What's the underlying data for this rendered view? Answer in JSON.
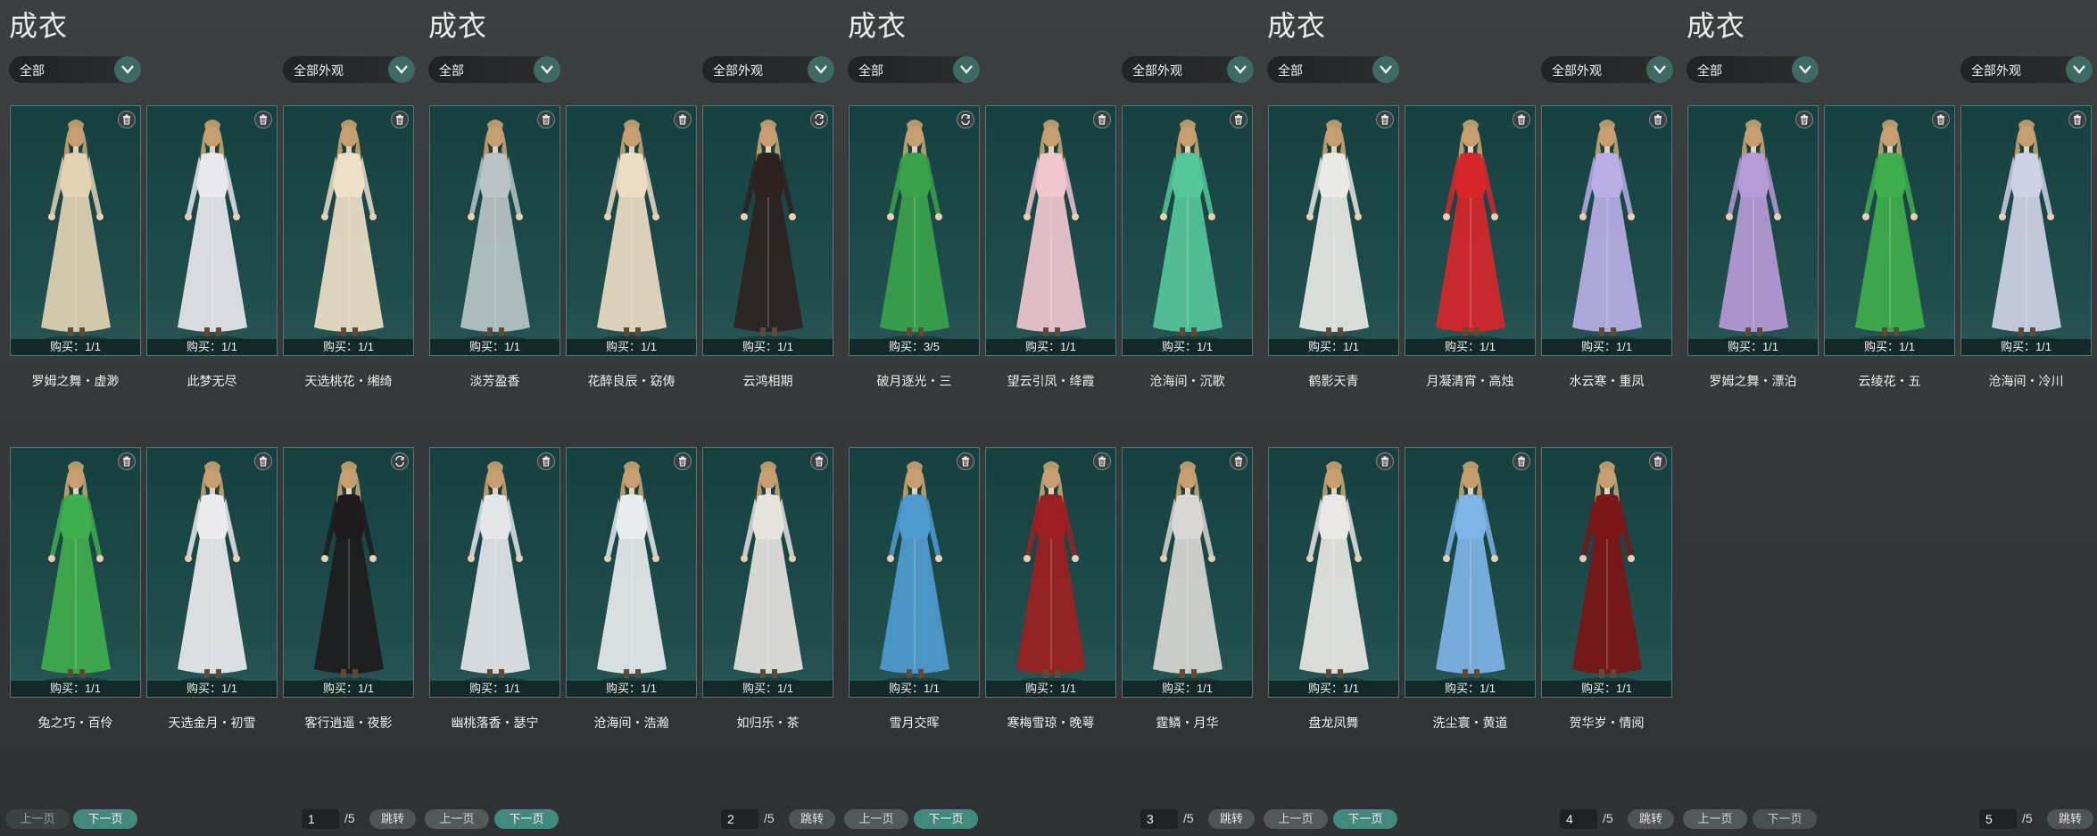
{
  "colors": {
    "background": "#363a3b",
    "card": "#1b4847",
    "accent": "#3f8a7c"
  },
  "pages": [
    {
      "title": "成衣",
      "category_select": "全部",
      "appearance_select": "全部外观",
      "cards": [
        {
          "name": "罗姆之舞・虚渺",
          "purchase": "购买：1/1",
          "icon": "trash-icon",
          "outfit": "#e2d3b4"
        },
        {
          "name": "此梦无尽",
          "purchase": "购买：1/1",
          "icon": "trash-icon",
          "outfit": "#e8e8ee"
        },
        {
          "name": "天选桃花・缃绮",
          "purchase": "购买：1/1",
          "icon": "trash-icon",
          "outfit": "#eedfc8"
        },
        {
          "name": "兔之巧・百伶",
          "purchase": "购买：1/1",
          "icon": "trash-icon",
          "outfit": "#3fae4c"
        },
        {
          "name": "天选金月・初雪",
          "purchase": "购买：1/1",
          "icon": "trash-icon",
          "outfit": "#ececee"
        },
        {
          "name": "客行逍遥・夜影",
          "purchase": "购买：1/1",
          "icon": "swap-icon",
          "outfit": "#1d1b1c"
        }
      ],
      "pager": {
        "prev": "上一页",
        "next": "下一页",
        "page": "1",
        "total": "/5",
        "jump": "跳转"
      }
    },
    {
      "title": "成衣",
      "category_select": "全部",
      "appearance_select": "全部外观",
      "cards": [
        {
          "name": "淡芳盈香",
          "purchase": "购买：1/1",
          "icon": "trash-icon",
          "outfit": "#b9c4c6"
        },
        {
          "name": "花醉良辰・窈俦",
          "purchase": "购买：1/1",
          "icon": "trash-icon",
          "outfit": "#ecdcc4"
        },
        {
          "name": "云鸿相期",
          "purchase": "购买：1/1",
          "icon": "swap-icon",
          "outfit": "#2c2220"
        },
        {
          "name": "幽桃落香・瑟宁",
          "purchase": "购买：1/1",
          "icon": "trash-icon",
          "outfit": "#e4e6ea"
        },
        {
          "name": "沧海间・浩瀚",
          "purchase": "购买：1/1",
          "icon": "trash-icon",
          "outfit": "#e8ecee"
        },
        {
          "name": "如归乐・茶",
          "purchase": "购买：1/1",
          "icon": "trash-icon",
          "outfit": "#e6e3de"
        }
      ],
      "pager": {
        "prev": "上一页",
        "next": "下一页",
        "page": "2",
        "total": "/5",
        "jump": "跳转"
      }
    },
    {
      "title": "成衣",
      "category_select": "全部",
      "appearance_select": "全部外观",
      "cards": [
        {
          "name": "破月逐光・三",
          "purchase": "购买：3/5",
          "icon": "swap-icon",
          "outfit": "#3aa34a"
        },
        {
          "name": "望云引凤・绛霞",
          "purchase": "购买：1/1",
          "icon": "trash-icon",
          "outfit": "#f1c7cf"
        },
        {
          "name": "沧海间・沉歌",
          "purchase": "购买：1/1",
          "icon": "trash-icon",
          "outfit": "#55c79a"
        },
        {
          "name": "雪月交晖",
          "purchase": "购买：1/1",
          "icon": "trash-icon",
          "outfit": "#4f9bd0"
        },
        {
          "name": "寒梅雪琼・晚萼",
          "purchase": "购买：1/1",
          "icon": "trash-icon",
          "outfit": "#9d1f22"
        },
        {
          "name": "霆鳞・月华",
          "purchase": "购买：1/1",
          "icon": "trash-icon",
          "outfit": "#d9d7d3"
        }
      ],
      "pager": {
        "prev": "上一页",
        "next": "下一页",
        "page": "3",
        "total": "/5",
        "jump": "跳转"
      }
    },
    {
      "title": "成衣",
      "category_select": "全部",
      "appearance_select": "全部外观",
      "cards": [
        {
          "name": "鹤影天青",
          "purchase": "购买：1/1",
          "icon": "trash-icon",
          "outfit": "#e9e9e6"
        },
        {
          "name": "月凝清宵・高烛",
          "purchase": "购买：1/1",
          "icon": "trash-icon",
          "outfit": "#d7262a"
        },
        {
          "name": "水云寒・重凤",
          "purchase": "购买：1/1",
          "icon": "trash-icon",
          "outfit": "#b9aee6"
        },
        {
          "name": "盘龙凤舞",
          "purchase": "购买：1/1",
          "icon": "trash-icon",
          "outfit": "#eae8e4"
        },
        {
          "name": "洗尘寰・黄道",
          "purchase": "购买：1/1",
          "icon": "trash-icon",
          "outfit": "#7fb4e6"
        },
        {
          "name": "贺华岁・情阅",
          "purchase": "购买：1/1",
          "icon": "trash-icon",
          "outfit": "#7c1516"
        }
      ],
      "pager": {
        "prev": "上一页",
        "next": "下一页",
        "page": "4",
        "total": "/5",
        "jump": "跳转"
      }
    },
    {
      "title": "成衣",
      "category_select": "全部",
      "appearance_select": "全部外观",
      "cards": [
        {
          "name": "罗姆之舞・漂泊",
          "purchase": "购买：1/1",
          "icon": "trash-icon",
          "outfit": "#b79ad8"
        },
        {
          "name": "云绫花・五",
          "purchase": "购买：1/1",
          "icon": "trash-icon",
          "outfit": "#3fae4c"
        },
        {
          "name": "沧海间・冷川",
          "purchase": "购买：1/1",
          "icon": "trash-icon",
          "outfit": "#cfd2e6"
        }
      ],
      "pager": {
        "prev": "上一页",
        "next": "下一页",
        "page": "5",
        "total": "/5",
        "jump": "跳转"
      }
    }
  ]
}
